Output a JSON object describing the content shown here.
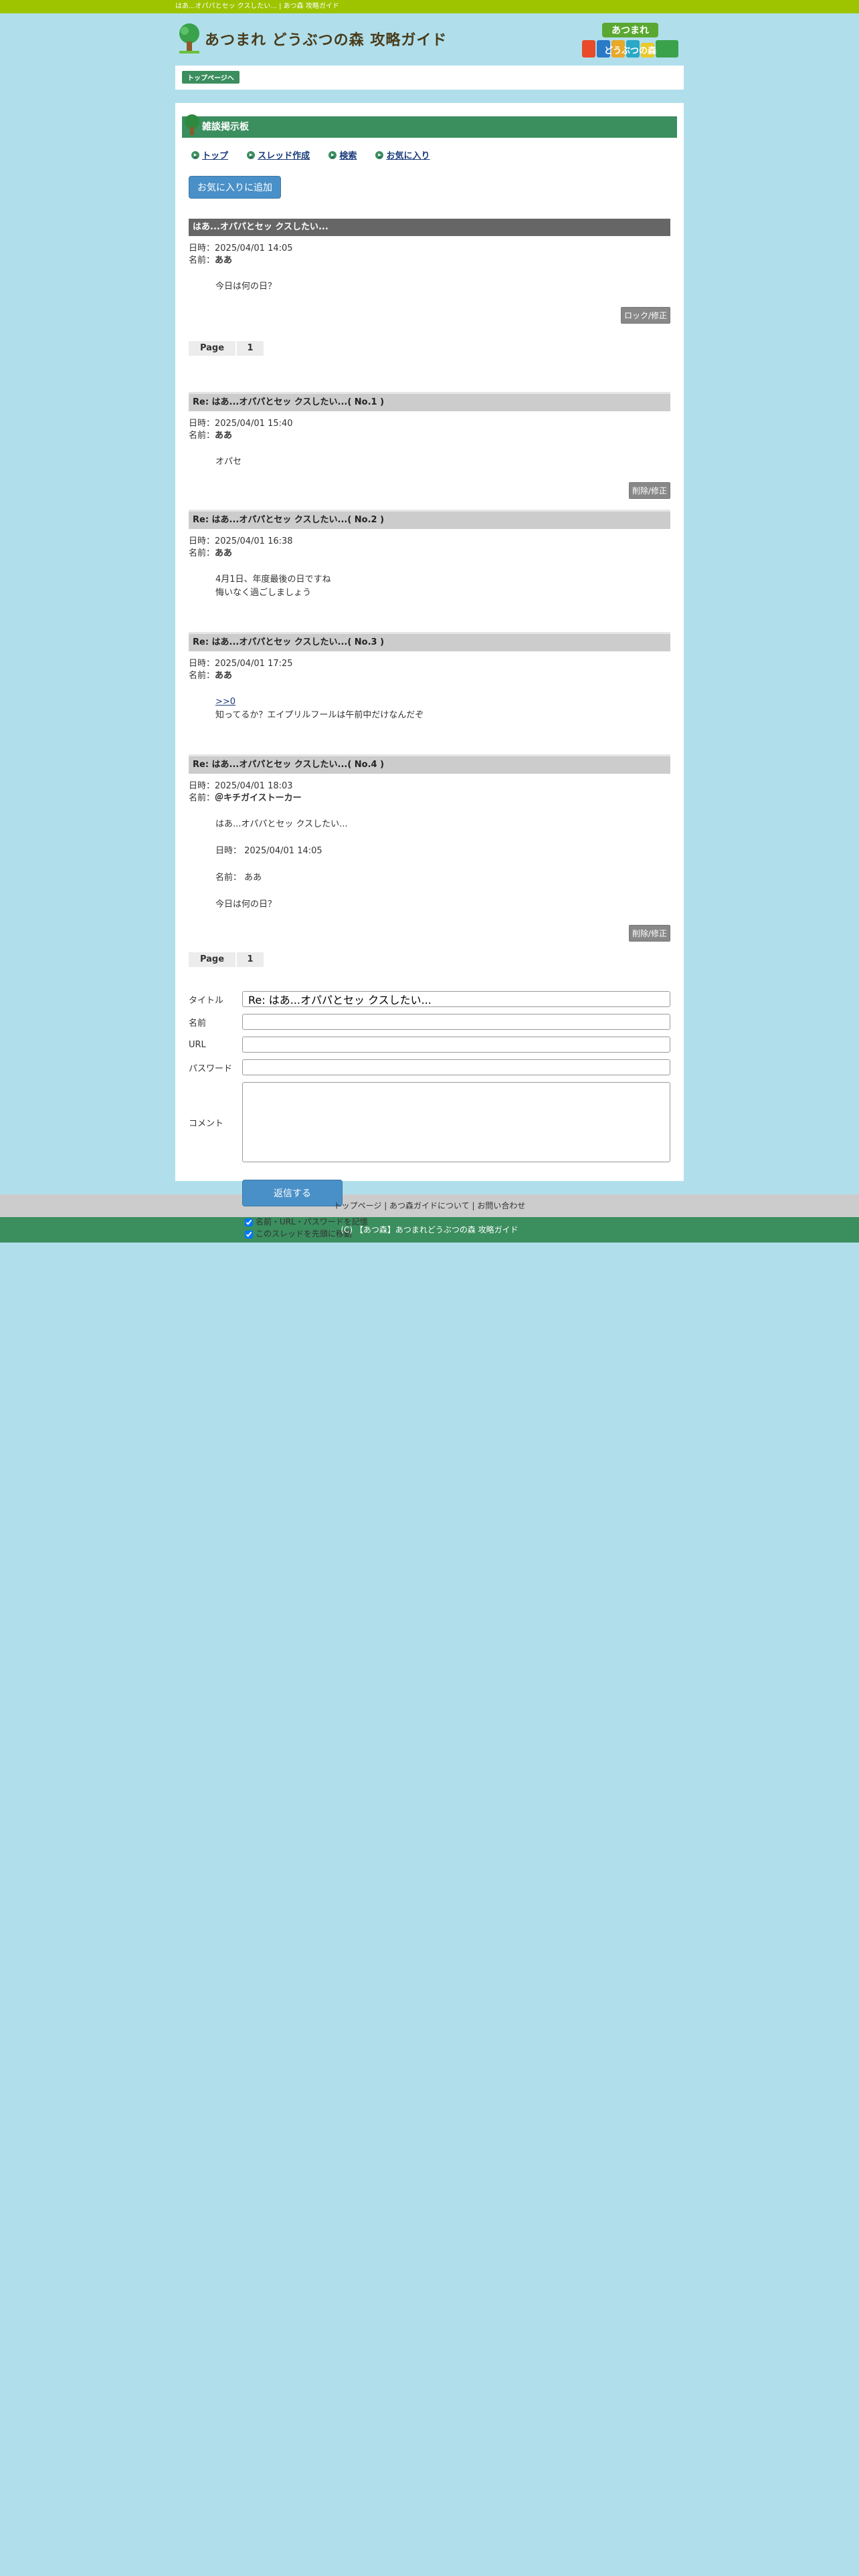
{
  "topbar": {
    "text": "はあ...オパパとセッ クスしたい... | あつ森 攻略ガイド"
  },
  "header": {
    "site_title": "あつまれ どうぶつの森 攻略ガイド",
    "badge_top": "あつまれ",
    "badge_bottom": "どうぶつの森"
  },
  "breadcrumb": {
    "label": "トップページへ"
  },
  "board": {
    "title": "雑談掲示板",
    "nav": [
      "トップ",
      "スレッド作成",
      "検索",
      "お気に入り"
    ],
    "fav_button": "お気に入りに追加"
  },
  "thread": {
    "title": "はあ...オパパとセッ クスしたい...",
    "date_label": "日時：",
    "name_label": "名前：",
    "date": "2025/04/01 14:05",
    "name": "ああ",
    "body": "今日は何の日？",
    "lock_button": "ロック/修正"
  },
  "pager": {
    "label": "Page",
    "page": "1"
  },
  "replies": [
    {
      "title": "Re: はあ...オパパとセッ クスしたい...( No.1 )",
      "date": "2025/04/01 15:40",
      "name": "ああ",
      "lines": [
        "オパセ"
      ],
      "button": "削除/修正"
    },
    {
      "title": "Re: はあ...オパパとセッ クスしたい...( No.2 )",
      "date": "2025/04/01 16:38",
      "name": "ああ",
      "lines": [
        "4月1日、年度最後の日ですね",
        "悔いなく過ごしましょう"
      ],
      "button": ""
    },
    {
      "title": "Re: はあ...オパパとセッ クスしたい...( No.3 )",
      "date": "2025/04/01 17:25",
      "name": "ああ",
      "link": ">>0",
      "lines": [
        "知ってるか？エイプリルフールは午前中だけなんだぞ"
      ],
      "button": ""
    },
    {
      "title": "Re: はあ...オパパとセッ クスしたい...( No.4 )",
      "date": "2025/04/01 18:03",
      "name": "＠キチガイストーカー",
      "lines": [
        "はあ...オパパとセッ クスしたい...",
        "",
        "日時： 2025/04/01 14:05",
        "",
        "名前： ああ",
        "",
        "今日は何の日？"
      ],
      "button": "削除/修正"
    }
  ],
  "form": {
    "title_label": "タイトル",
    "title_value": "Re: はあ...オパパとセッ クスしたい...",
    "name_label": "名前",
    "url_label": "URL",
    "password_label": "パスワード",
    "comment_label": "コメント",
    "submit": "返信する",
    "check1": "名前・URL・パスワードを記憶",
    "check2": "このスレッドを先頭に移動"
  },
  "footer": {
    "links": [
      "トップページ",
      "あつ森ガイドについて",
      "お問い合わせ"
    ],
    "separator": " | ",
    "copyright": "(C) 【あつ森】あつまれどうぶつの森 攻略ガイド"
  },
  "colors": {
    "topbar": "#9ec400",
    "accent": "#3b8e5e",
    "bg": "#b0dfeb",
    "button": "#4a90c8"
  }
}
